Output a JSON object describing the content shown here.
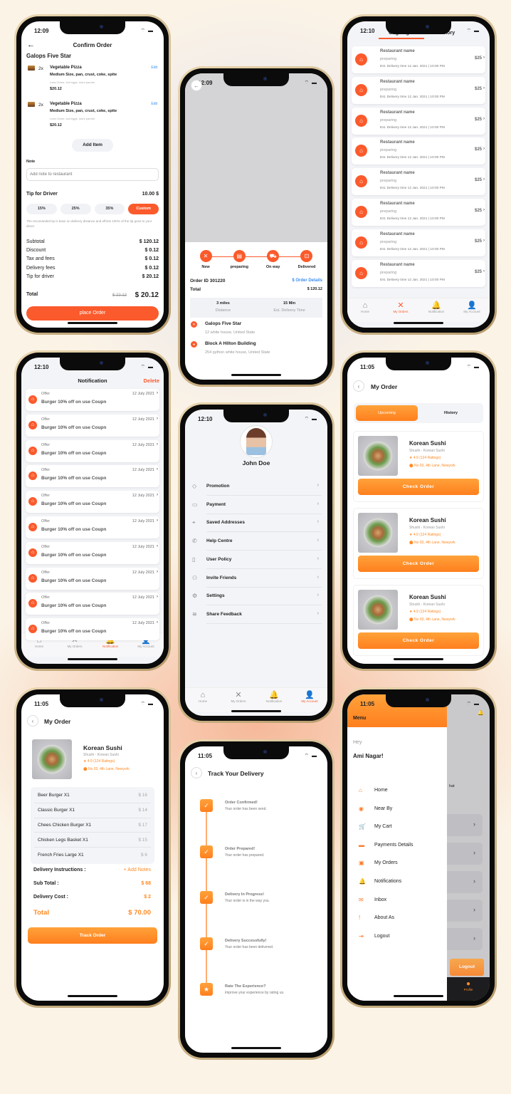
{
  "colors": {
    "accent": "#fb5a2c",
    "orange": "#ff8a25",
    "background": "#fbf3e6"
  },
  "confirm": {
    "time": "12:09",
    "title": "Confirm Order",
    "restaurant": "Galops Five Star",
    "items": [
      {
        "qty": "2x",
        "name": "Vegetable Pizza",
        "desc": "Medium Size, pan, crust, coke, spite",
        "note": "Less Onion, boil eggs, more panner",
        "price": "$20.12",
        "edit": "Edit"
      },
      {
        "qty": "2x",
        "name": "Vegetable Pizza",
        "desc": "Medium Size, pan, crust, coke, spite",
        "note": "Less Onion, boil eggs, more panner",
        "price": "$20.12",
        "edit": "Edit"
      }
    ],
    "add_item": "Add Item",
    "note_label": "Note",
    "note_placeholder": "Add note to restaurant",
    "tip_label": "Tip for Driver",
    "tip_value": "10.00 $",
    "tips": [
      "15%",
      "25%",
      "35%",
      "Custom"
    ],
    "tip_hint": "The recomanded tip is base on delivery distance and efforts 100% of the tip gose to your dirver",
    "summary": [
      {
        "label": "Subtotal",
        "value": "$ 120.12"
      },
      {
        "label": "Discount",
        "value": "$ 0.12"
      },
      {
        "label": "Tax and fees",
        "value": "$ 0.12"
      },
      {
        "label": "Delivery fees",
        "value": "$ 0.12"
      },
      {
        "label": "Tip for driver",
        "value": "$ 20.12"
      }
    ],
    "total_label": "Total",
    "old_total": "$ 22.12",
    "total": "$ 20.12",
    "place_order": "place Order"
  },
  "tracking": {
    "time": "12:09",
    "steps": [
      "New",
      "preparing",
      "On way",
      "Delivered"
    ],
    "order_id": "Order ID 301220",
    "order_details": "$ Order Details",
    "total_label": "Total",
    "total": "$ 120.12",
    "distance": "3 miles",
    "distance_label": "Distance",
    "eta": "15 Min",
    "eta_label": "Est. Delivery Time",
    "from_name": "Galops Five Star",
    "from_addr": "12 white house, United State",
    "to_name": "Block A Hilton Building",
    "to_addr": "254 python white house, United State"
  },
  "orders": {
    "time": "12:10",
    "tabs": [
      "Ongoing",
      "History"
    ],
    "item": {
      "name": "Restaurant name",
      "status": "preparing",
      "eta": "Est. Delivery time 12 Jan. 2021 | 10:00 PM",
      "price": "$25"
    },
    "nav": [
      "Home",
      "My Orders",
      "Notification",
      "My Account"
    ]
  },
  "notifications": {
    "time": "12:10",
    "title": "Notification",
    "delete": "Delete",
    "item": {
      "type": "Offer",
      "text": "Burger 10% off on use Coupn",
      "date": "12 July 2021"
    },
    "nav": [
      "Home",
      "My Orders",
      "Notification",
      "My Account"
    ]
  },
  "account": {
    "time": "12:10",
    "name": "John Doe",
    "menu": [
      "Promotion",
      "Payment",
      "Saved Addresses",
      "Help Centre",
      "User Policy",
      "Invite Friends",
      "Settings",
      "Share Feedback"
    ],
    "icons": [
      "tag-icon",
      "card-icon",
      "location-icon",
      "phone-icon",
      "document-icon",
      "add-user-icon",
      "gear-icon",
      "database-icon"
    ],
    "nav": [
      "Home",
      "My Orders",
      "Notification",
      "My Account"
    ]
  },
  "my_orders": {
    "time": "11:05",
    "title": "My Order",
    "tabs": [
      "Upcoming",
      "History"
    ],
    "card": {
      "name": "Korean Sushi",
      "sub": "Shushi - Korean Sushi",
      "rating": "4.9 (124 Ratings)",
      "address": "No 03, 4th Lane, Newyork",
      "button": "Check Order"
    }
  },
  "order_detail": {
    "time": "11:05",
    "title": "My Order",
    "name": "Korean Sushi",
    "sub": "Shushi - Korean Sushi",
    "rating": "4.9 (124 Ratings)",
    "address": "No 03, 4th Lane, Newyork",
    "items": [
      {
        "name": "Beer Burger X1",
        "price": "$ 16"
      },
      {
        "name": "Classic Burger X1",
        "price": "$ 14"
      },
      {
        "name": "Chees Chicken Burger X1",
        "price": "$ 17"
      },
      {
        "name": "Chicken Legs Basket X1",
        "price": "$ 15"
      },
      {
        "name": "French Fries Large X1",
        "price": "$ 6"
      }
    ],
    "instructions_label": "Delivery Instructions :",
    "add_notes": "+ Add Notes",
    "subtotal_label": "Sub Total :",
    "subtotal": "$ 68",
    "delivery_label": "Delivery Cost :",
    "delivery": "$ 2",
    "total_label": "Total",
    "total": "$ 70.00",
    "track": "Track Order"
  },
  "track_delivery": {
    "time": "11:05",
    "title": "Track Your Delivery",
    "steps": [
      {
        "title": "Order Confirmed!",
        "desc": "Your order has been send."
      },
      {
        "title": "Order Prepared!",
        "desc": "Your order has prepared."
      },
      {
        "title": "Delivery In Progress!",
        "desc": "Your order is in the way you."
      },
      {
        "title": "Delivery Successfully!",
        "desc": "Your order has been delivered."
      },
      {
        "title": "Rate The Experience?",
        "desc": "improve your experience by rating us."
      }
    ]
  },
  "drawer": {
    "time": "11:05",
    "title": "Menu",
    "greeting": "Hey",
    "user": "Ami Nagar!",
    "items": [
      "Home",
      "Near By",
      "My Cart",
      "Payments Details",
      "My Orders",
      "Notifications",
      "Inbox",
      "About As",
      "Logout"
    ],
    "icons": [
      "home-icon",
      "compass-icon",
      "cart-icon",
      "card-icon",
      "bag-icon",
      "bell-icon",
      "mail-icon",
      "exclamation-icon",
      "logout-icon"
    ],
    "bg_text": "hat",
    "bg_logout": "Logout",
    "bg_profile": "Profile"
  }
}
